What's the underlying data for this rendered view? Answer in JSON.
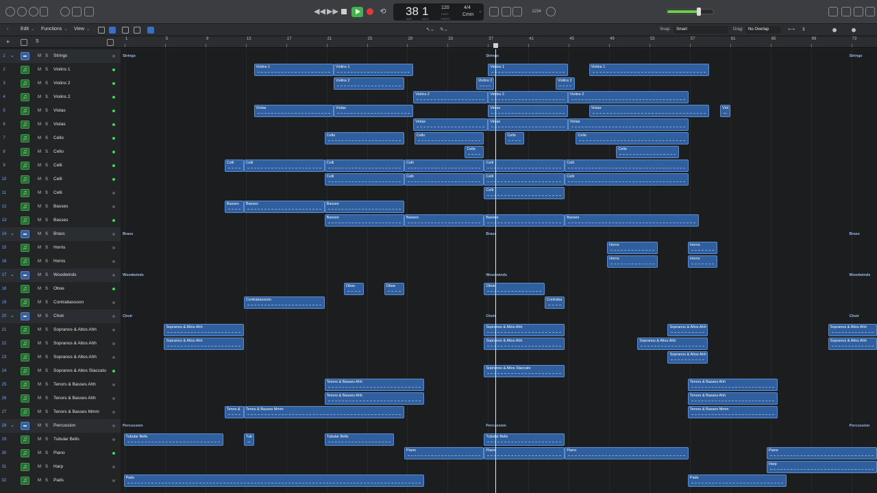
{
  "transport": {
    "bar": "38",
    "beat": "1",
    "bar_label": "BAR",
    "beat_label": "BEAT",
    "tempo": "120",
    "tempo_label": "KEEP",
    "tempo_sub": "TEMPO",
    "time_signature": "4/4",
    "key": "Cmin"
  },
  "toolbar": {
    "edit": "Edit",
    "functions": "Functions",
    "view": "View",
    "snap_label": "Snap:",
    "snap_value": "Smart",
    "drag_label": "Drag:",
    "drag_value": "No Overlap",
    "m_label": "M",
    "s_label": "S"
  },
  "colors": {
    "region": "#2f5f9e",
    "play": "#3fb54a",
    "record": "#e0393e",
    "led_green": "#3ddc5a",
    "track_number": "#78a9ff"
  },
  "ruler": [
    "1",
    "5",
    "9",
    "13",
    "17",
    "21",
    "25",
    "29",
    "33",
    "37",
    "41",
    "45",
    "49",
    "53",
    "57",
    "61",
    "65",
    "69",
    "73"
  ],
  "tracks": [
    {
      "num": "1",
      "name": "Strings",
      "type": "folder",
      "led": "off"
    },
    {
      "num": "2",
      "name": "Violins 1",
      "type": "inst",
      "led": "on"
    },
    {
      "num": "3",
      "name": "Violins 2",
      "type": "inst",
      "led": "on"
    },
    {
      "num": "4",
      "name": "Violins 2",
      "type": "inst",
      "led": "on"
    },
    {
      "num": "5",
      "name": "Violas",
      "type": "inst",
      "led": "on"
    },
    {
      "num": "6",
      "name": "Violas",
      "type": "inst",
      "led": "on"
    },
    {
      "num": "7",
      "name": "Cello",
      "type": "inst",
      "led": "on"
    },
    {
      "num": "8",
      "name": "Cello",
      "type": "inst",
      "led": "on"
    },
    {
      "num": "9",
      "name": "Celli",
      "type": "inst",
      "led": "on"
    },
    {
      "num": "10",
      "name": "Celli",
      "type": "inst",
      "led": "on"
    },
    {
      "num": "11",
      "name": "Celli",
      "type": "inst",
      "led": "off"
    },
    {
      "num": "12",
      "name": "Basses",
      "type": "inst",
      "led": "off"
    },
    {
      "num": "13",
      "name": "Basses",
      "type": "inst",
      "led": "on"
    },
    {
      "num": "14",
      "name": "Brass",
      "type": "folder",
      "led": "off"
    },
    {
      "num": "15",
      "name": "Horns",
      "type": "inst",
      "led": "off"
    },
    {
      "num": "16",
      "name": "Horns",
      "type": "inst",
      "led": "off"
    },
    {
      "num": "17",
      "name": "Woodwinds",
      "type": "folder",
      "led": "off"
    },
    {
      "num": "18",
      "name": "Oboe",
      "type": "inst",
      "led": "on"
    },
    {
      "num": "19",
      "name": "Contrabassoon",
      "type": "inst",
      "led": "off"
    },
    {
      "num": "20",
      "name": "Choir",
      "type": "folder",
      "led": "off"
    },
    {
      "num": "21",
      "name": "Sopranos & Altos Ahh",
      "type": "inst",
      "led": "off"
    },
    {
      "num": "22",
      "name": "Sopranos & Altos Ahh",
      "type": "inst",
      "led": "off"
    },
    {
      "num": "23",
      "name": "Sopranos & Altos Ahh",
      "type": "inst",
      "led": "off"
    },
    {
      "num": "24",
      "name": "Sopranos & Altos Staccato",
      "type": "inst",
      "led": "on"
    },
    {
      "num": "25",
      "name": "Tenors & Basses Ahh",
      "type": "inst",
      "led": "off"
    },
    {
      "num": "26",
      "name": "Tenors & Basses Ahh",
      "type": "inst",
      "led": "off"
    },
    {
      "num": "27",
      "name": "Tenors & Basses Mmm",
      "type": "inst",
      "led": "off"
    },
    {
      "num": "28",
      "name": "Percussion",
      "type": "folder",
      "led": "off"
    },
    {
      "num": "29",
      "name": "Tubular Bells",
      "type": "inst",
      "led": "off"
    },
    {
      "num": "30",
      "name": "Piano",
      "type": "inst",
      "led": "on"
    },
    {
      "num": "31",
      "name": "Harp",
      "type": "inst",
      "led": "off"
    },
    {
      "num": "32",
      "name": "Pads",
      "type": "inst",
      "led": "off"
    }
  ],
  "folder_labels": [
    {
      "track": 0,
      "name": "Strings",
      "bars": [
        1,
        37,
        73
      ]
    },
    {
      "track": 13,
      "name": "Brass",
      "bars": [
        1,
        37,
        73
      ]
    },
    {
      "track": 16,
      "name": "Woodwinds",
      "bars": [
        1,
        37,
        73
      ]
    },
    {
      "track": 19,
      "name": "Choir",
      "bars": [
        1,
        37,
        73
      ]
    },
    {
      "track": 27,
      "name": "Percussion",
      "bars": [
        1,
        37,
        73
      ]
    }
  ],
  "regions": [
    {
      "track": 1,
      "name": "Violins 1",
      "start": 13.8,
      "end": 21.7
    },
    {
      "track": 1,
      "name": "Violins 1",
      "start": 21.7,
      "end": 29.6
    },
    {
      "track": 1,
      "name": "Violins 1",
      "start": 37.0,
      "end": 44.9
    },
    {
      "track": 1,
      "name": "Violins 1",
      "start": 47.0,
      "end": 58.9
    },
    {
      "track": 2,
      "name": "Violins 2",
      "start": 21.7,
      "end": 28.7
    },
    {
      "track": 2,
      "name": "Violins 2",
      "start": 35.8,
      "end": 37.6
    },
    {
      "track": 2,
      "name": "Violins 2",
      "start": 43.7,
      "end": 45.6
    },
    {
      "track": 3,
      "name": "Violins 2",
      "start": 29.6,
      "end": 37.0
    },
    {
      "track": 3,
      "name": "Violins 2",
      "start": 37.0,
      "end": 44.9
    },
    {
      "track": 3,
      "name": "Violins 2",
      "start": 44.9,
      "end": 56.9
    },
    {
      "track": 4,
      "name": "Violas",
      "start": 13.8,
      "end": 21.7
    },
    {
      "track": 4,
      "name": "Violas",
      "start": 21.7,
      "end": 29.6
    },
    {
      "track": 4,
      "name": "Violas",
      "start": 37.0,
      "end": 44.9
    },
    {
      "track": 4,
      "name": "Violas",
      "start": 47.0,
      "end": 58.9
    },
    {
      "track": 4,
      "name": "Viol",
      "start": 60.0,
      "end": 61.0
    },
    {
      "track": 5,
      "name": "Violas",
      "start": 29.6,
      "end": 37.0
    },
    {
      "track": 5,
      "name": "Violas",
      "start": 37.0,
      "end": 44.9
    },
    {
      "track": 5,
      "name": "Violas",
      "start": 44.9,
      "end": 56.9
    },
    {
      "track": 6,
      "name": "Cello",
      "start": 20.8,
      "end": 28.7
    },
    {
      "track": 6,
      "name": "Cello",
      "start": 29.7,
      "end": 36.6
    },
    {
      "track": 6,
      "name": "Cello",
      "start": 38.7,
      "end": 40.6
    },
    {
      "track": 6,
      "name": "Cello",
      "start": 45.7,
      "end": 56.9
    },
    {
      "track": 7,
      "name": "Cello",
      "start": 34.7,
      "end": 36.6
    },
    {
      "track": 7,
      "name": "Cello",
      "start": 49.7,
      "end": 55.9
    },
    {
      "track": 8,
      "name": "Celli",
      "start": 10.9,
      "end": 12.8
    },
    {
      "track": 8,
      "name": "Celli",
      "start": 12.8,
      "end": 20.8
    },
    {
      "track": 8,
      "name": "Celli",
      "start": 20.8,
      "end": 28.7
    },
    {
      "track": 8,
      "name": "Celli",
      "start": 28.7,
      "end": 36.6
    },
    {
      "track": 8,
      "name": "Celli",
      "start": 36.6,
      "end": 44.6
    },
    {
      "track": 8,
      "name": "Celli",
      "start": 44.6,
      "end": 56.9
    },
    {
      "track": 9,
      "name": "Celli",
      "start": 20.8,
      "end": 28.7
    },
    {
      "track": 9,
      "name": "Celli",
      "start": 28.7,
      "end": 36.6
    },
    {
      "track": 9,
      "name": "Celli",
      "start": 36.6,
      "end": 44.6
    },
    {
      "track": 9,
      "name": "Celli",
      "start": 44.6,
      "end": 56.9
    },
    {
      "track": 10,
      "name": "Celli",
      "start": 36.6,
      "end": 44.6
    },
    {
      "track": 11,
      "name": "Basses",
      "start": 10.9,
      "end": 12.8
    },
    {
      "track": 11,
      "name": "Basses",
      "start": 12.8,
      "end": 20.8
    },
    {
      "track": 11,
      "name": "Basses",
      "start": 20.8,
      "end": 28.7
    },
    {
      "track": 12,
      "name": "Basses",
      "start": 20.8,
      "end": 28.7
    },
    {
      "track": 12,
      "name": "Basses",
      "start": 28.7,
      "end": 36.6
    },
    {
      "track": 12,
      "name": "Basses",
      "start": 36.6,
      "end": 44.6
    },
    {
      "track": 12,
      "name": "Basses",
      "start": 44.6,
      "end": 57.9
    },
    {
      "track": 14,
      "name": "Horns",
      "start": 48.8,
      "end": 53.8
    },
    {
      "track": 14,
      "name": "Horns",
      "start": 56.8,
      "end": 59.7
    },
    {
      "track": 15,
      "name": "Horns",
      "start": 48.8,
      "end": 53.8
    },
    {
      "track": 15,
      "name": "Horns",
      "start": 56.8,
      "end": 59.7
    },
    {
      "track": 17,
      "name": "Oboe",
      "start": 22.7,
      "end": 24.7
    },
    {
      "track": 17,
      "name": "Oboe",
      "start": 26.7,
      "end": 28.7
    },
    {
      "track": 17,
      "name": "Oboe",
      "start": 36.6,
      "end": 42.6
    },
    {
      "track": 18,
      "name": "Contrabassoon",
      "start": 12.8,
      "end": 20.8
    },
    {
      "track": 18,
      "name": "Contraba",
      "start": 42.6,
      "end": 44.6
    },
    {
      "track": 20,
      "name": "Sopranos & Altos Ahh",
      "start": 4.9,
      "end": 12.8
    },
    {
      "track": 20,
      "name": "Sopranos & Altos Ahh",
      "start": 36.6,
      "end": 44.6
    },
    {
      "track": 20,
      "name": "Sopranos & Altos Ahh",
      "start": 54.8,
      "end": 58.8
    },
    {
      "track": 20,
      "name": "Sopranos & Altos Ahh",
      "start": 70.7,
      "end": 76.6
    },
    {
      "track": 21,
      "name": "Sopranos & Altos Ahh",
      "start": 4.9,
      "end": 12.8
    },
    {
      "track": 21,
      "name": "Sopranos & Altos Ahh",
      "start": 36.6,
      "end": 44.6
    },
    {
      "track": 21,
      "name": "Sopranos & Altos Ahh",
      "start": 51.8,
      "end": 58.8
    },
    {
      "track": 21,
      "name": "Sopranos & Altos Ahh",
      "start": 70.7,
      "end": 76.6
    },
    {
      "track": 22,
      "name": "Sopranos & Altos Ahh",
      "start": 54.8,
      "end": 58.8
    },
    {
      "track": 23,
      "name": "Sopranos & Altos Staccato",
      "start": 36.6,
      "end": 44.6
    },
    {
      "track": 24,
      "name": "Tenors & Basses Ahh",
      "start": 20.8,
      "end": 30.7
    },
    {
      "track": 24,
      "name": "Tenors & Basses Ahh",
      "start": 56.8,
      "end": 65.7
    },
    {
      "track": 25,
      "name": "Tenors & Basses Ahh",
      "start": 20.8,
      "end": 30.7
    },
    {
      "track": 25,
      "name": "Tenors & Basses Ahh",
      "start": 56.8,
      "end": 65.7
    },
    {
      "track": 26,
      "name": "Tenos &",
      "start": 10.9,
      "end": 12.8
    },
    {
      "track": 26,
      "name": "Tenos & Basses Mmm",
      "start": 12.8,
      "end": 28.7
    },
    {
      "track": 26,
      "name": "Tenors & Basses Mmm",
      "start": 56.8,
      "end": 65.7
    },
    {
      "track": 28,
      "name": "Tubular Bells",
      "start": 0.9,
      "end": 10.8
    },
    {
      "track": 28,
      "name": "Tub",
      "start": 12.8,
      "end": 13.8
    },
    {
      "track": 28,
      "name": "Tubular Bells",
      "start": 20.8,
      "end": 27.7
    },
    {
      "track": 28,
      "name": "Tubular Bells",
      "start": 36.6,
      "end": 44.6
    },
    {
      "track": 29,
      "name": "Piano",
      "start": 28.7,
      "end": 36.6
    },
    {
      "track": 29,
      "name": "Piano",
      "start": 36.6,
      "end": 44.6
    },
    {
      "track": 29,
      "name": "Piano",
      "start": 44.6,
      "end": 56.9
    },
    {
      "track": 29,
      "name": "Piano",
      "start": 64.6,
      "end": 75.6
    },
    {
      "track": 30,
      "name": "Harp",
      "start": 64.6,
      "end": 75.6
    },
    {
      "track": 31,
      "name": "Pads",
      "start": 0.9,
      "end": 30.7
    },
    {
      "track": 31,
      "name": "Pads",
      "start": 56.8,
      "end": 66.6
    }
  ],
  "playhead_bar": 38
}
